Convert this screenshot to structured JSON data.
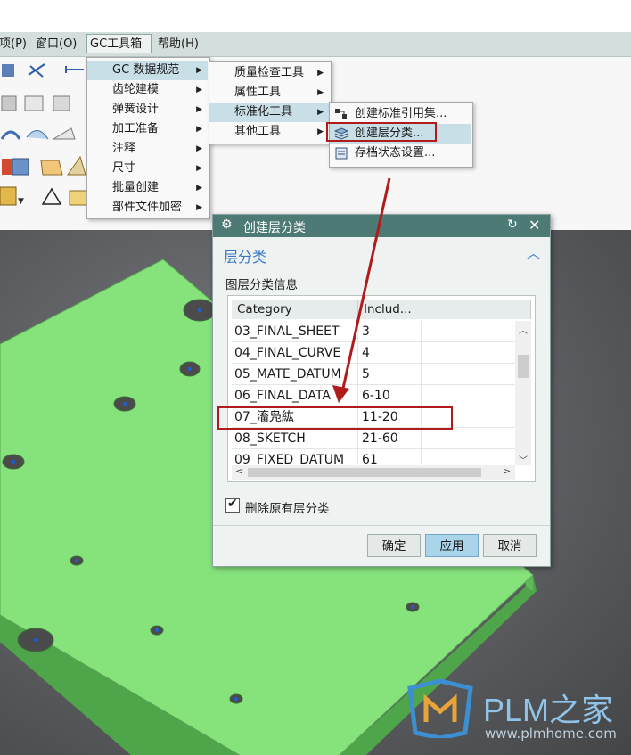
{
  "menubar": {
    "items": [
      {
        "label": "项(P)"
      },
      {
        "label": "窗口(O)"
      },
      {
        "label": "GC工具箱"
      },
      {
        "label": "帮助(H)"
      }
    ]
  },
  "gc_menu": {
    "items": [
      {
        "label": "GC 数据规范"
      },
      {
        "label": "齿轮建模"
      },
      {
        "label": "弹簧设计"
      },
      {
        "label": "加工准备"
      },
      {
        "label": "注释"
      },
      {
        "label": "尺寸"
      },
      {
        "label": "批量创建"
      },
      {
        "label": "部件文件加密"
      }
    ]
  },
  "data_spec_menu": {
    "items": [
      {
        "label": "质量检查工具"
      },
      {
        "label": "属性工具"
      },
      {
        "label": "标准化工具"
      },
      {
        "label": "其他工具"
      }
    ]
  },
  "std_tools_menu": {
    "items": [
      {
        "label": "创建标准引用集..."
      },
      {
        "label": "创建层分类..."
      },
      {
        "label": "存档状态设置..."
      }
    ]
  },
  "dialog": {
    "title": "创建层分类",
    "section_title": "层分类",
    "group_label": "图层分类信息",
    "columns": [
      "Category",
      "Includ..."
    ],
    "rows": [
      {
        "category": "03_FINAL_SHEET",
        "includes": "3"
      },
      {
        "category": "04_FINAL_CURVE",
        "includes": "4"
      },
      {
        "category": "05_MATE_DATUM",
        "includes": "5"
      },
      {
        "category": "06_FINAL_DATA",
        "includes": "6-10"
      },
      {
        "category": "07_滀凫紘",
        "includes": "11-20"
      },
      {
        "category": "08_SKETCH",
        "includes": "21-60"
      },
      {
        "category": "09_FIXED_DATUM",
        "includes": "61"
      }
    ],
    "checkbox_label": "删除原有层分类",
    "checkbox_checked": true,
    "buttons": {
      "ok": "确定",
      "apply": "应用",
      "cancel": "取消"
    }
  },
  "watermark": {
    "brand": "PLM之家",
    "url": "www.plmhome.com"
  },
  "colors": {
    "title_bar": "#4d7a75",
    "highlight": "#c9dfe8",
    "annotation_red": "#b01c1c",
    "model_green": "#86e37c"
  }
}
